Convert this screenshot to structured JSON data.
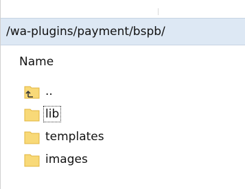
{
  "location": {
    "path": "/wa-plugins/payment/bspb/"
  },
  "list": {
    "column_header": "Name",
    "rows": [
      {
        "label": "..",
        "icon": "folder-up-icon",
        "focused": false
      },
      {
        "label": "lib",
        "icon": "folder-icon",
        "focused": true
      },
      {
        "label": "templates",
        "icon": "folder-icon",
        "focused": false
      },
      {
        "label": "images",
        "icon": "folder-icon",
        "focused": false
      }
    ]
  },
  "colors": {
    "path_bar_bg": "#dde8f4",
    "folder_fill": "#f8d978",
    "folder_shadow": "#e2b53e",
    "up_arrow": "#3a3a3a"
  }
}
